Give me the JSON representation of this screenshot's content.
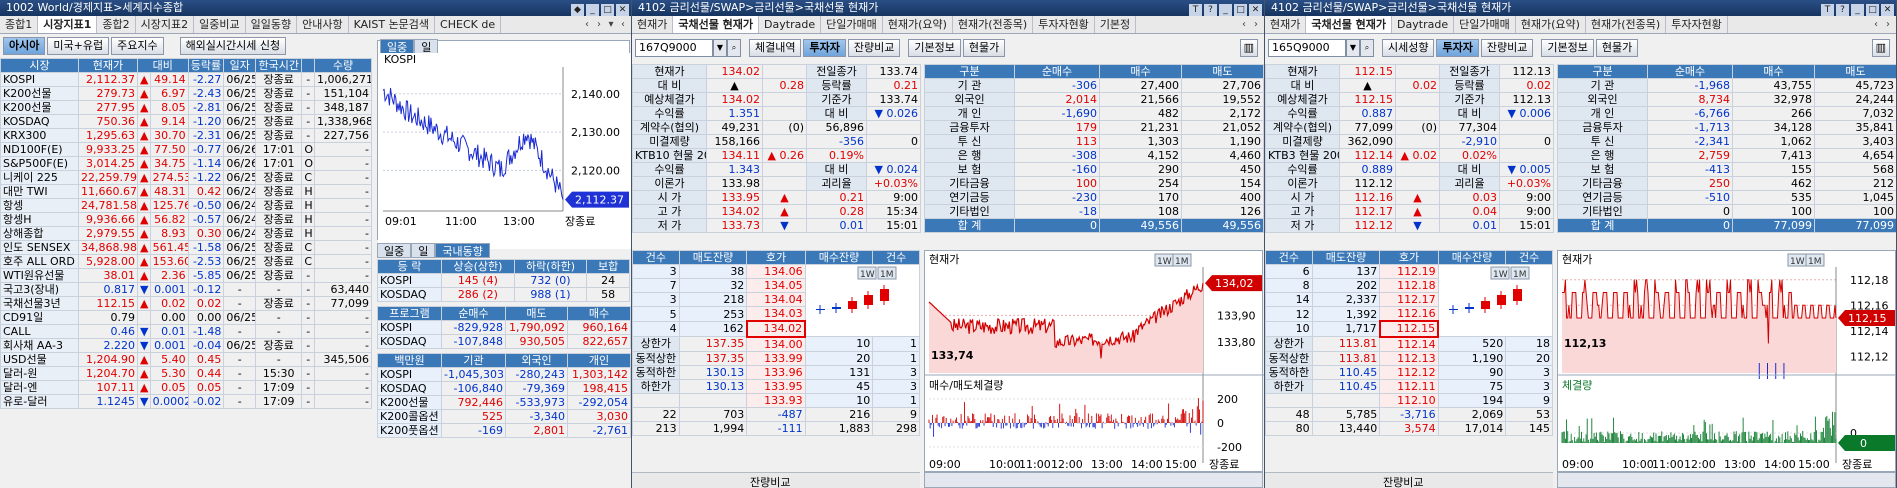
{
  "w1": {
    "title": "1002 World/경제지표>세계지수종합",
    "tabs": [
      "종합1",
      "시장지표1",
      "종합2",
      "시장지표2",
      "일중비교",
      "일일동향",
      "안내사항",
      "KAIST 논문검색",
      "CHECK de"
    ],
    "btns": [
      "아시아",
      "미국+유럽",
      "주요지수",
      "해외실시간시세 신청"
    ],
    "cols": [
      "시장",
      "현재가",
      "대비",
      "등락률",
      "일자",
      "한국시간",
      "",
      "수량"
    ],
    "rows": [
      [
        "KOSPI",
        "2,112.37",
        "▲",
        "49.14",
        "-2.27",
        "06/25",
        "장종료",
        "-",
        "1,006,271"
      ],
      [
        "K200선물",
        "279.73",
        "▲",
        "6.97",
        "-2.43",
        "06/25",
        "장종료",
        "-",
        "151,104"
      ],
      [
        "K200선물",
        "277.95",
        "▲",
        "8.05",
        "-2.81",
        "06/25",
        "장종료",
        "-",
        "348,187"
      ],
      [
        "KOSDAQ",
        "750.36",
        "▲",
        "9.14",
        "-1.20",
        "06/25",
        "장종료",
        "-",
        "1,338,968"
      ],
      [
        "KRX300",
        "1,295.63",
        "▲",
        "30.70",
        "-2.31",
        "06/25",
        "장종료",
        "-",
        "227,756"
      ],
      [
        "ND100F(E)",
        "9,933.25",
        "▲",
        "77.50",
        "-0.77",
        "06/26",
        "17:01",
        "O",
        "-"
      ],
      [
        "S&P500F(E)",
        "3,014.25",
        "▲",
        "34.75",
        "-1.14",
        "06/26",
        "17:01",
        "O",
        "-"
      ],
      [
        "니케이 225",
        "22,259.79",
        "▲",
        "274.53",
        "-1.22",
        "06/25",
        "장종료",
        "C",
        "-"
      ],
      [
        "대만 TWI",
        "11,660.67",
        "▲",
        "48.31",
        "0.42",
        "06/24",
        "장종료",
        "H",
        "-"
      ],
      [
        "항셍",
        "24,781.58",
        "▲",
        "125.76",
        "-0.50",
        "06/24",
        "장종료",
        "H",
        "-"
      ],
      [
        "항셍H",
        "9,936.66",
        "▲",
        "56.82",
        "-0.57",
        "06/24",
        "장종료",
        "H",
        "-"
      ],
      [
        "상해종합",
        "2,979.55",
        "▲",
        "8.93",
        "0.30",
        "06/24",
        "장종료",
        "H",
        "-"
      ],
      [
        "인도 SENSEX",
        "34,868.98",
        "▲",
        "561.45",
        "-1.58",
        "06/25",
        "장종료",
        "C",
        "-"
      ],
      [
        "호주 ALL ORD",
        "5,928.00",
        "▲",
        "153.60",
        "-2.53",
        "06/25",
        "장종료",
        "C",
        "-"
      ],
      [
        "WTI원유선물",
        "38.01",
        "▲",
        "2.36",
        "-5.85",
        "06/25",
        "장종료",
        "-",
        "-"
      ],
      [
        "국고3(장내)",
        "0.817",
        "▼",
        "0.001",
        "-0.12",
        "-",
        "-",
        "-",
        "63,440"
      ],
      [
        "국채선물3년",
        "112.15",
        "▲",
        "0.02",
        "0.02",
        "-",
        "장종료",
        "-",
        "77,099"
      ],
      [
        "CD91일",
        "0.79",
        "",
        "0.00",
        "0.00",
        "06/25",
        "-",
        "-",
        "-"
      ],
      [
        "CALL",
        "0.46",
        "▼",
        "0.01",
        "-1.48",
        "-",
        "-",
        "-",
        "-"
      ],
      [
        "회사채 AA-3",
        "2.220",
        "▼",
        "0.001",
        "-0.04",
        "06/25",
        "장종료",
        "-",
        "-"
      ],
      [
        "USD선물",
        "1,204.90",
        "▲",
        "5.40",
        "0.45",
        "-",
        "-",
        "-",
        "345,506"
      ],
      [
        "달러-원",
        "1,204.70",
        "▲",
        "5.30",
        "0.44",
        "-",
        "15:30",
        "-",
        "-"
      ],
      [
        "달러-엔",
        "107.11",
        "▲",
        "0.05",
        "0.05",
        "-",
        "17:09",
        "-",
        "-"
      ],
      [
        "유로-달러",
        "1.1245",
        "▼",
        "0.0002",
        "-0.02",
        "-",
        "17:09",
        "-",
        "-"
      ]
    ],
    "chart_tabs": [
      "일중",
      "일"
    ],
    "chart": {
      "type": "line",
      "title": "KOSPI",
      "y_ticks": [
        "2,140.00",
        "2,130.00",
        "2,120.00"
      ],
      "ylim": [
        2112,
        2147
      ],
      "x_ticks": [
        "09:01",
        "11:00",
        "13:00"
      ],
      "last": "2,112.37",
      "status": "장종료"
    },
    "panel_tabs": [
      "일중",
      "일",
      "국내동향"
    ],
    "updown": {
      "cols": [
        "등 락",
        "상승(상한)",
        "하락(하한)",
        "보합"
      ],
      "rows": [
        [
          "KOSPI",
          "145",
          "(4)",
          "732",
          "(0)",
          "24"
        ],
        [
          "KOSDAQ",
          "286",
          "(2)",
          "988",
          "(1)",
          "58"
        ]
      ]
    },
    "prog": {
      "cols": [
        "프로그램",
        "순매수",
        "매도",
        "매수"
      ],
      "rows": [
        [
          "KOSPI",
          "-829,928",
          "1,790,092",
          "960,164"
        ],
        [
          "KOSDAQ",
          "-107,848",
          "930,505",
          "822,657"
        ]
      ]
    },
    "inv": {
      "cols": [
        "백만원",
        "기관",
        "외국인",
        "개인"
      ],
      "rows": [
        [
          "KOSPI",
          "-1,045,303",
          "-280,243",
          "1,303,142"
        ],
        [
          "KOSDAQ",
          "-106,840",
          "-79,369",
          "198,415"
        ],
        [
          "K200선물",
          "792,446",
          "-533,973",
          "-292,054"
        ],
        [
          "K200콜옵션",
          "525",
          "-3,340",
          "3,030"
        ],
        [
          "K200풋옵션",
          "-169",
          "2,801",
          "-2,761"
        ]
      ]
    }
  },
  "w2": {
    "title": "4102 금리선물/SWAP>금리선물>국채선물 현재가",
    "tabs": [
      "현재가",
      "국채선물 현재가",
      "Daytrade",
      "단일가매매",
      "현재가(요약)",
      "현재가(전종목)",
      "투자자현황",
      "기본정"
    ],
    "code": "167Q9000",
    "btns": [
      "체결내역",
      "투자자",
      "잔량비교",
      "기본정보",
      "현물가"
    ],
    "info": [
      [
        "현재가",
        "134.02",
        "",
        "전일종가",
        "133.74"
      ],
      [
        "대 비",
        "▲",
        "0.28",
        "등락률",
        "0.21"
      ],
      [
        "예상체결가",
        "134.02",
        "",
        "기준가",
        "133.74"
      ],
      [
        "수익률",
        "1.351",
        "",
        "대 비",
        "▼ 0.026"
      ],
      [
        "계약수(협의)",
        "49,231",
        "(0)",
        "56,896",
        ""
      ],
      [
        "미결제량",
        "158,166",
        "",
        "-356",
        "0"
      ],
      [
        "KTB10 현물 20",
        "134.11",
        "▲ 0.26",
        "0.19%",
        ""
      ],
      [
        "수익률",
        "1.343",
        "",
        "대 비",
        "▼ 0.024"
      ],
      [
        "이론가",
        "133.98",
        "",
        "괴리율",
        "+0.03%"
      ],
      [
        "시 가",
        "133.95",
        "▲",
        "0.21",
        "9:00"
      ],
      [
        "고 가",
        "134.02",
        "▲",
        "0.28",
        "15:34"
      ],
      [
        "저 가",
        "133.73",
        "▼",
        "0.01",
        "15:01"
      ]
    ],
    "invcols": [
      "구분",
      "순매수",
      "매수",
      "매도"
    ],
    "invrows": [
      [
        "기 관",
        "-306",
        "27,400",
        "27,706"
      ],
      [
        "외국인",
        "2,014",
        "21,566",
        "19,552"
      ],
      [
        "개 인",
        "-1,690",
        "482",
        "2,172"
      ],
      [
        "금융투자",
        "179",
        "21,231",
        "21,052"
      ],
      [
        "투 신",
        "113",
        "1,303",
        "1,190"
      ],
      [
        "은 행",
        "-308",
        "4,152",
        "4,460"
      ],
      [
        "보 험",
        "-160",
        "290",
        "450"
      ],
      [
        "기타금융",
        "100",
        "254",
        "154"
      ],
      [
        "연기금등",
        "-230",
        "170",
        "400"
      ],
      [
        "기타법인",
        "-18",
        "108",
        "126"
      ],
      [
        "합 계",
        "0",
        "49,556",
        "49,556"
      ]
    ],
    "obcols": [
      "건수",
      "매도잔량",
      "호가",
      "매수잔량",
      "건수"
    ],
    "asks": [
      [
        "3",
        "38",
        "134.06"
      ],
      [
        "7",
        "32",
        "134.05"
      ],
      [
        "3",
        "218",
        "134.04"
      ],
      [
        "5",
        "253",
        "134.03"
      ],
      [
        "4",
        "162",
        "134.02"
      ]
    ],
    "bids": [
      [
        "134.00",
        "10",
        "1"
      ],
      [
        "133.99",
        "20",
        "1"
      ],
      [
        "133.96",
        "131",
        "3"
      ],
      [
        "133.95",
        "45",
        "3"
      ],
      [
        "133.93",
        "10",
        "1"
      ]
    ],
    "limits": [
      [
        "상한가",
        "137.35"
      ],
      [
        "동적상한",
        "137.35"
      ],
      [
        "동적하한",
        "130.13"
      ],
      [
        "하한가",
        "130.13"
      ]
    ],
    "obtot": [
      [
        "22",
        "703",
        "-487",
        "216",
        "9"
      ],
      [
        "213",
        "1,994",
        "-111",
        "1,883",
        "298"
      ]
    ],
    "chart": {
      "type": "line",
      "title": "현재가",
      "y_ticks": [
        "133,90",
        "133,80"
      ],
      "ylim": [
        133.7,
        134.08
      ],
      "low": "133,74",
      "last": "134,02",
      "sub_title": "매수/매도체결량",
      "sub_ticks": [
        "200",
        "0",
        "-200"
      ],
      "x_ticks": [
        "09:00",
        "10:00",
        "11:00",
        "12:00",
        "13:00",
        "14:00",
        "15:00"
      ],
      "status": "장종료"
    },
    "bottom": "잔량비교"
  },
  "w3": {
    "title": "4102 금리선물/SWAP>금리선물>국채선물 현재가",
    "tabs": [
      "현재가",
      "국채선물 현재가",
      "Daytrade",
      "단일가매매",
      "현재가(요약)",
      "현재가(전종목)",
      "투자자현황"
    ],
    "code": "165Q9000",
    "btns": [
      "시세성향",
      "투자자",
      "잔량비교",
      "기본정보",
      "현물가"
    ],
    "info": [
      [
        "현재가",
        "112.15",
        "",
        "전일종가",
        "112.13"
      ],
      [
        "대 비",
        "▲",
        "0.02",
        "등락률",
        "0.02"
      ],
      [
        "예상체결가",
        "112.15",
        "",
        "기준가",
        "112.13"
      ],
      [
        "수익률",
        "0.887",
        "",
        "대 비",
        "▼ 0.006"
      ],
      [
        "계약수(협의)",
        "77,099",
        "(0)",
        "77,304",
        ""
      ],
      [
        "미결제량",
        "362,090",
        "",
        "-2,910",
        "0"
      ],
      [
        "KTB3 현물 200",
        "112.14",
        "▲ 0.02",
        "0.02%",
        ""
      ],
      [
        "수익률",
        "0.889",
        "",
        "대 비",
        "▼ 0.005"
      ],
      [
        "이론가",
        "112.12",
        "",
        "괴리율",
        "+0.03%"
      ],
      [
        "시 가",
        "112.16",
        "▲",
        "0.03",
        "9:00"
      ],
      [
        "고 가",
        "112.17",
        "▲",
        "0.04",
        "9:00"
      ],
      [
        "저 가",
        "112.12",
        "▼",
        "0.01",
        "15:01"
      ]
    ],
    "invcols": [
      "구분",
      "순매수",
      "매수",
      "매도"
    ],
    "invrows": [
      [
        "기 관",
        "-1,968",
        "43,755",
        "45,723"
      ],
      [
        "외국인",
        "8,734",
        "32,978",
        "24,244"
      ],
      [
        "개 인",
        "-6,766",
        "266",
        "7,032"
      ],
      [
        "금융투자",
        "-1,713",
        "34,128",
        "35,841"
      ],
      [
        "투 신",
        "-2,341",
        "1,062",
        "3,403"
      ],
      [
        "은 행",
        "2,759",
        "7,413",
        "4,654"
      ],
      [
        "보 험",
        "-413",
        "155",
        "568"
      ],
      [
        "기타금융",
        "250",
        "462",
        "212"
      ],
      [
        "연기금등",
        "-510",
        "535",
        "1,045"
      ],
      [
        "기타법인",
        "0",
        "100",
        "100"
      ],
      [
        "합 계",
        "0",
        "77,099",
        "77,099"
      ]
    ],
    "obcols": [
      "건수",
      "매도잔량",
      "호가",
      "매수잔량",
      "건수"
    ],
    "asks": [
      [
        "6",
        "137",
        "112.19"
      ],
      [
        "8",
        "202",
        "112.18"
      ],
      [
        "14",
        "2,337",
        "112.17"
      ],
      [
        "12",
        "1,392",
        "112.16"
      ],
      [
        "10",
        "1,717",
        "112.15"
      ]
    ],
    "bids": [
      [
        "112.14",
        "520",
        "18"
      ],
      [
        "112.13",
        "1,190",
        "20"
      ],
      [
        "112.12",
        "90",
        "3"
      ],
      [
        "112.11",
        "75",
        "3"
      ],
      [
        "112.10",
        "194",
        "9"
      ]
    ],
    "limits": [
      [
        "상한가",
        "113.81"
      ],
      [
        "동적상한",
        "113.81"
      ],
      [
        "동적하한",
        "110.45"
      ],
      [
        "하한가",
        "110.45"
      ]
    ],
    "obtot": [
      [
        "48",
        "5,785",
        "-3,716",
        "2,069",
        "53"
      ],
      [
        "80",
        "13,440",
        "3,574",
        "17,014",
        "145"
      ]
    ],
    "chart": {
      "type": "line",
      "title": "현재가",
      "y_ticks": [
        "112,18",
        "112,16",
        "112,14",
        "112,12"
      ],
      "ylim": [
        112.11,
        112.19
      ],
      "low": "112,13",
      "last": "112,15",
      "sub_title": "체결량",
      "sub_ticks": [
        "0"
      ],
      "x_ticks": [
        "09:00",
        "10:00",
        "11:00",
        "12:00",
        "13:00",
        "14:00",
        "15:00"
      ],
      "status": "장종료"
    },
    "bottom": "잔량비교"
  }
}
